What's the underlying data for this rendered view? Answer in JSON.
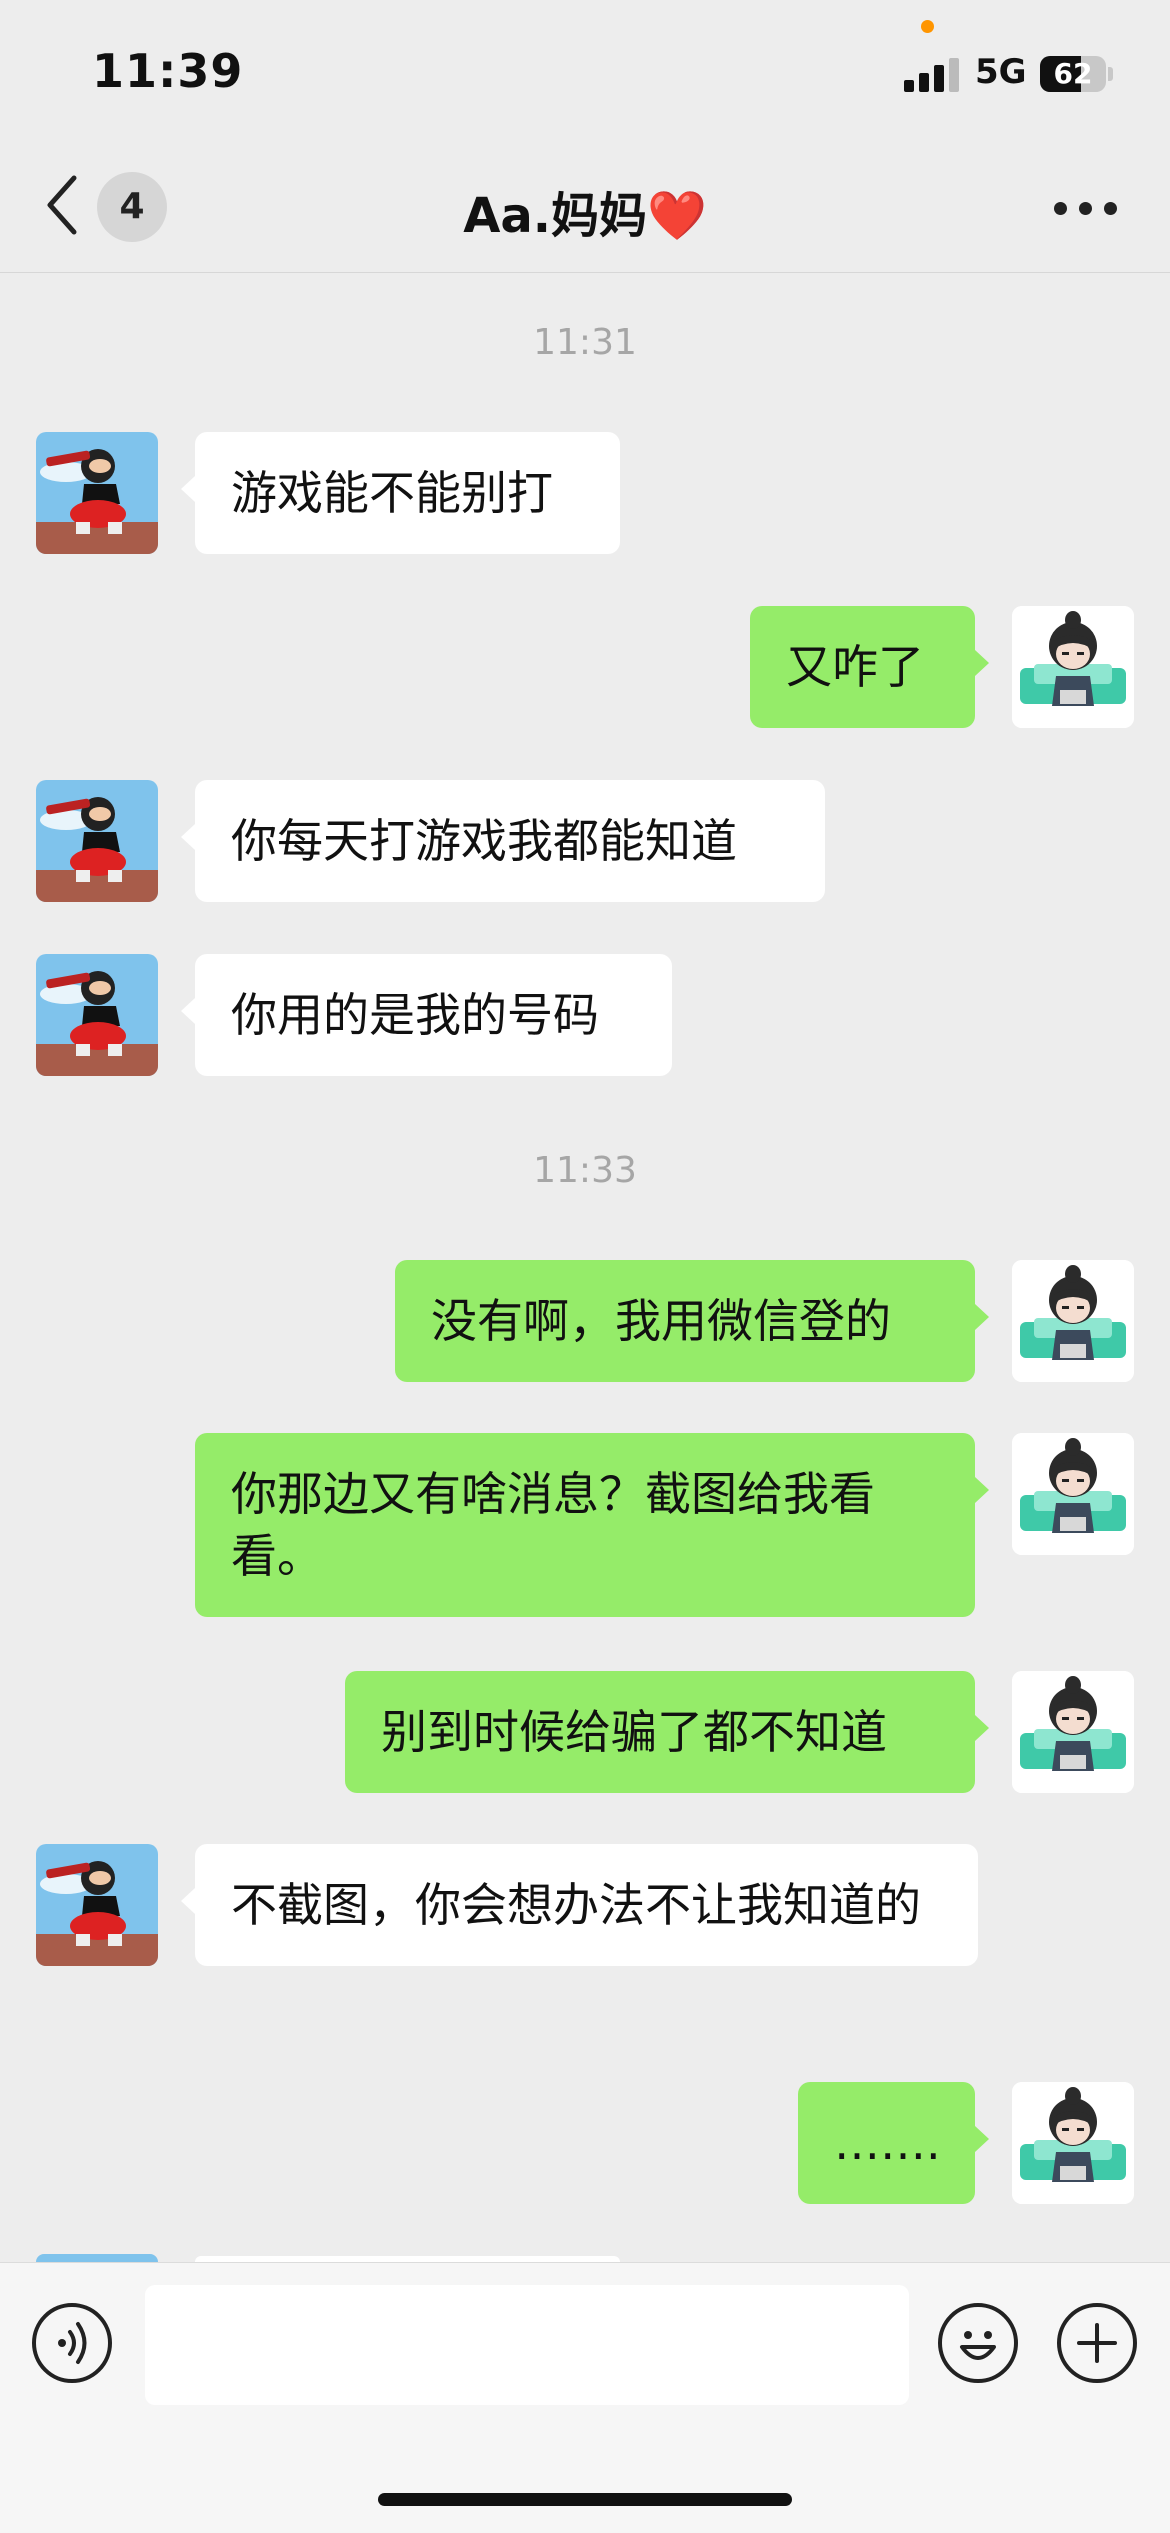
{
  "status_bar": {
    "time": "11:39",
    "network": "5G",
    "battery": "62",
    "battery_level": 0.62
  },
  "header": {
    "back_icon": "chevron-left-icon",
    "unread_count": "4",
    "title": "Aa.妈妈❤️",
    "more_icon": "more-dots-icon"
  },
  "messages": [
    {
      "type": "time",
      "text": "11:31"
    },
    {
      "type": "msg",
      "from": "mom",
      "text": "游戏能不能别打"
    },
    {
      "type": "msg",
      "from": "me",
      "text": "又咋了"
    },
    {
      "type": "msg",
      "from": "mom",
      "text": "你每天打游戏我都能知道"
    },
    {
      "type": "msg",
      "from": "mom",
      "text": "你用的是我的号码"
    },
    {
      "type": "time",
      "text": "11:33"
    },
    {
      "type": "msg",
      "from": "me",
      "text": "没有啊，我用微信登的"
    },
    {
      "type": "msg",
      "from": "me",
      "text": "你那边又有啥消息？截图给我看看。"
    },
    {
      "type": "msg",
      "from": "me",
      "text": "别到时候给骗了都不知道"
    },
    {
      "type": "msg",
      "from": "mom",
      "text": "不截图，你会想办法不让我知道的"
    },
    {
      "type": "msg",
      "from": "me",
      "text": "……."
    }
  ],
  "input_bar": {
    "voice_icon": "voice-icon",
    "emoji_icon": "emoji-icon",
    "plus_icon": "plus-icon",
    "input_value": ""
  },
  "colors": {
    "background": "#ededed",
    "outgoing_bubble": "#95ec69",
    "incoming_bubble": "#ffffff"
  }
}
